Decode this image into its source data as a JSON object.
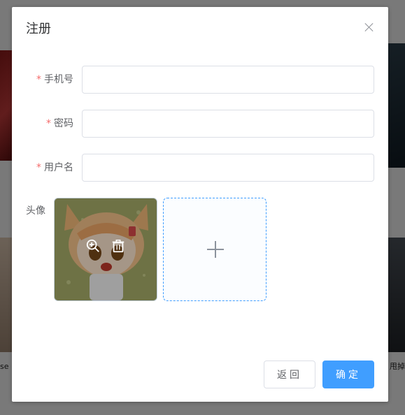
{
  "background": {
    "left_snippet": "se",
    "right_snippet": "甩掉"
  },
  "dialog": {
    "title": "注册",
    "close_icon": "close-icon",
    "fields": [
      {
        "label": "手机号",
        "required": true,
        "value": "",
        "placeholder": ""
      },
      {
        "label": "密码",
        "required": true,
        "value": "",
        "placeholder": ""
      },
      {
        "label": "用户名",
        "required": true,
        "value": "",
        "placeholder": ""
      }
    ],
    "avatar_label": "头像",
    "avatar_actions": [
      "zoom-in-icon",
      "delete-icon"
    ],
    "upload_icon": "plus-icon",
    "buttons": {
      "back": "返回",
      "confirm": "确定"
    }
  },
  "colors": {
    "primary": "#409eff",
    "required": "#f56c6c",
    "border": "#dcdfe6"
  }
}
